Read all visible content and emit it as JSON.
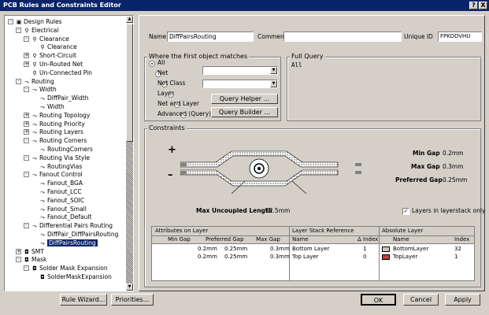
{
  "window": {
    "title": "PCB Rules and Constraints Editor",
    "help_btn": "?",
    "close_btn": "X"
  },
  "tree": [
    {
      "label": "Design Rules",
      "level": 0,
      "toggle": "-",
      "icon": "folder-icon"
    },
    {
      "label": "Electrical",
      "level": 1,
      "toggle": "-",
      "icon": "rule-icon"
    },
    {
      "label": "Clearance",
      "level": 2,
      "toggle": "-",
      "icon": "rule-icon"
    },
    {
      "label": "Clearance",
      "level": 3,
      "toggle": "",
      "icon": "rule-icon"
    },
    {
      "label": "Short-Circuit",
      "level": 2,
      "toggle": "+",
      "icon": "rule-icon"
    },
    {
      "label": "Un-Routed Net",
      "level": 2,
      "toggle": "+",
      "icon": "rule-icon"
    },
    {
      "label": "Un-Connected Pin",
      "level": 2,
      "toggle": "",
      "icon": "rule-icon"
    },
    {
      "label": "Routing",
      "level": 1,
      "toggle": "-",
      "icon": "route-icon"
    },
    {
      "label": "Width",
      "level": 2,
      "toggle": "-",
      "icon": "route-icon"
    },
    {
      "label": "DiffPair_Width",
      "level": 3,
      "toggle": "",
      "icon": "route-icon"
    },
    {
      "label": "Width",
      "level": 3,
      "toggle": "",
      "icon": "route-icon"
    },
    {
      "label": "Routing Topology",
      "level": 2,
      "toggle": "+",
      "icon": "route-icon"
    },
    {
      "label": "Routing Priority",
      "level": 2,
      "toggle": "+",
      "icon": "route-icon"
    },
    {
      "label": "Routing Layers",
      "level": 2,
      "toggle": "+",
      "icon": "route-icon"
    },
    {
      "label": "Routing Corners",
      "level": 2,
      "toggle": "-",
      "icon": "route-icon"
    },
    {
      "label": "RoutingCorners",
      "level": 3,
      "toggle": "",
      "icon": "route-icon"
    },
    {
      "label": "Routing Via Style",
      "level": 2,
      "toggle": "-",
      "icon": "route-icon"
    },
    {
      "label": "RoutingVias",
      "level": 3,
      "toggle": "",
      "icon": "route-icon"
    },
    {
      "label": "Fanout Control",
      "level": 2,
      "toggle": "-",
      "icon": "route-icon"
    },
    {
      "label": "Fanout_BGA",
      "level": 3,
      "toggle": "",
      "icon": "route-icon"
    },
    {
      "label": "Fanout_LCC",
      "level": 3,
      "toggle": "",
      "icon": "route-icon"
    },
    {
      "label": "Fanout_SOIC",
      "level": 3,
      "toggle": "",
      "icon": "route-icon"
    },
    {
      "label": "Fanout_Small",
      "level": 3,
      "toggle": "",
      "icon": "route-icon"
    },
    {
      "label": "Fanout_Default",
      "level": 3,
      "toggle": "",
      "icon": "route-icon"
    },
    {
      "label": "Differential Pairs Routing",
      "level": 2,
      "toggle": "-",
      "icon": "route-icon"
    },
    {
      "label": "DiffPair_DiffPairsRouting",
      "level": 3,
      "toggle": "",
      "icon": "route-icon"
    },
    {
      "label": "DiffPairsRouting",
      "level": 3,
      "toggle": "",
      "icon": "route-icon",
      "selected": true
    },
    {
      "label": "SMT",
      "level": 1,
      "toggle": "+",
      "icon": "smt-icon"
    },
    {
      "label": "Mask",
      "level": 1,
      "toggle": "-",
      "icon": "mask-icon"
    },
    {
      "label": "Solder Mask Expansion",
      "level": 2,
      "toggle": "-",
      "icon": "mask-icon"
    },
    {
      "label": "SolderMaskExpansion",
      "level": 3,
      "toggle": "",
      "icon": "mask-icon"
    }
  ],
  "rule": {
    "name_label": "Name",
    "name_value": "DiffPairsRouting",
    "comment_label": "Comment",
    "comment_value": "",
    "uid_label": "Unique ID",
    "uid_value": "FPKODVHU"
  },
  "where": {
    "title": "Where the First object matches",
    "options": [
      "All",
      "Net",
      "Net Class",
      "Layer",
      "Net and Layer",
      "Advanced (Query)"
    ],
    "selected": "All",
    "query_helper": "Query Helper ...",
    "query_builder": "Query Builder ..."
  },
  "full_query": {
    "title": "Full Query",
    "text": "All"
  },
  "constraints": {
    "title": "Constraints",
    "plus": "+",
    "minus": "–",
    "min_gap_label": "Min Gap",
    "min_gap_value": "0.2mm",
    "max_gap_label": "Max Gap",
    "max_gap_value": "0.3mm",
    "pref_gap_label": "Preferred Gap",
    "pref_gap_value": "0.25mm",
    "max_uncoupled_label": "Max Uncoupled Length",
    "max_uncoupled_value": "12.5mm",
    "layers_in_stack_label": "Layers in layerstack only",
    "layers_in_stack_checked": true
  },
  "table": {
    "group_headers": [
      "Attributes on Layer",
      "Layer Stack Reference",
      "Absolute Layer"
    ],
    "columns": [
      "Min Gap",
      "Preferred Gap",
      "Max Gap",
      "Name",
      "Δ",
      "Index",
      "Name",
      "Index"
    ],
    "rows": [
      {
        "min_gap": "0.2mm",
        "pref_gap": "0.25mm",
        "max_gap": "0.3mm",
        "stack_name": "Bottom Layer",
        "stack_index": "1",
        "abs_name": "BottomLayer",
        "abs_index": "32",
        "swatch": "#d0c8c0"
      },
      {
        "min_gap": "0.2mm",
        "pref_gap": "0.25mm",
        "max_gap": "0.3mm",
        "stack_name": "Top Layer",
        "stack_index": "0",
        "abs_name": "TopLayer",
        "abs_index": "1",
        "swatch": "#c04040"
      }
    ]
  },
  "buttons": {
    "rule_wizard": "Rule Wizard...",
    "priorities": "Priorities...",
    "ok": "OK",
    "cancel": "Cancel",
    "apply": "Apply"
  }
}
